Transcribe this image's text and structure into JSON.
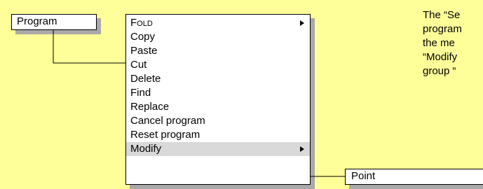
{
  "program_button": {
    "label": "Program"
  },
  "menu": {
    "items": [
      {
        "label": "Fold",
        "submenu": true
      },
      {
        "label": "Copy",
        "submenu": false
      },
      {
        "label": "Paste",
        "submenu": false
      },
      {
        "label": "Cut",
        "submenu": false
      },
      {
        "label": "Delete",
        "submenu": false
      },
      {
        "label": "Find",
        "submenu": false
      },
      {
        "label": "Replace",
        "submenu": false
      },
      {
        "label": "Cancel program",
        "submenu": false
      },
      {
        "label": "Reset program",
        "submenu": false
      },
      {
        "label": "Modify",
        "submenu": true,
        "selected": true
      }
    ]
  },
  "submenu": {
    "label": "Point"
  },
  "description": {
    "lines": [
      "The “Se",
      "program",
      "the  me",
      "“Modify",
      "group  “"
    ]
  },
  "colors": {
    "background": "#ffff99",
    "shadow": "#a9a9a9",
    "selected": "#d9d9d9"
  }
}
